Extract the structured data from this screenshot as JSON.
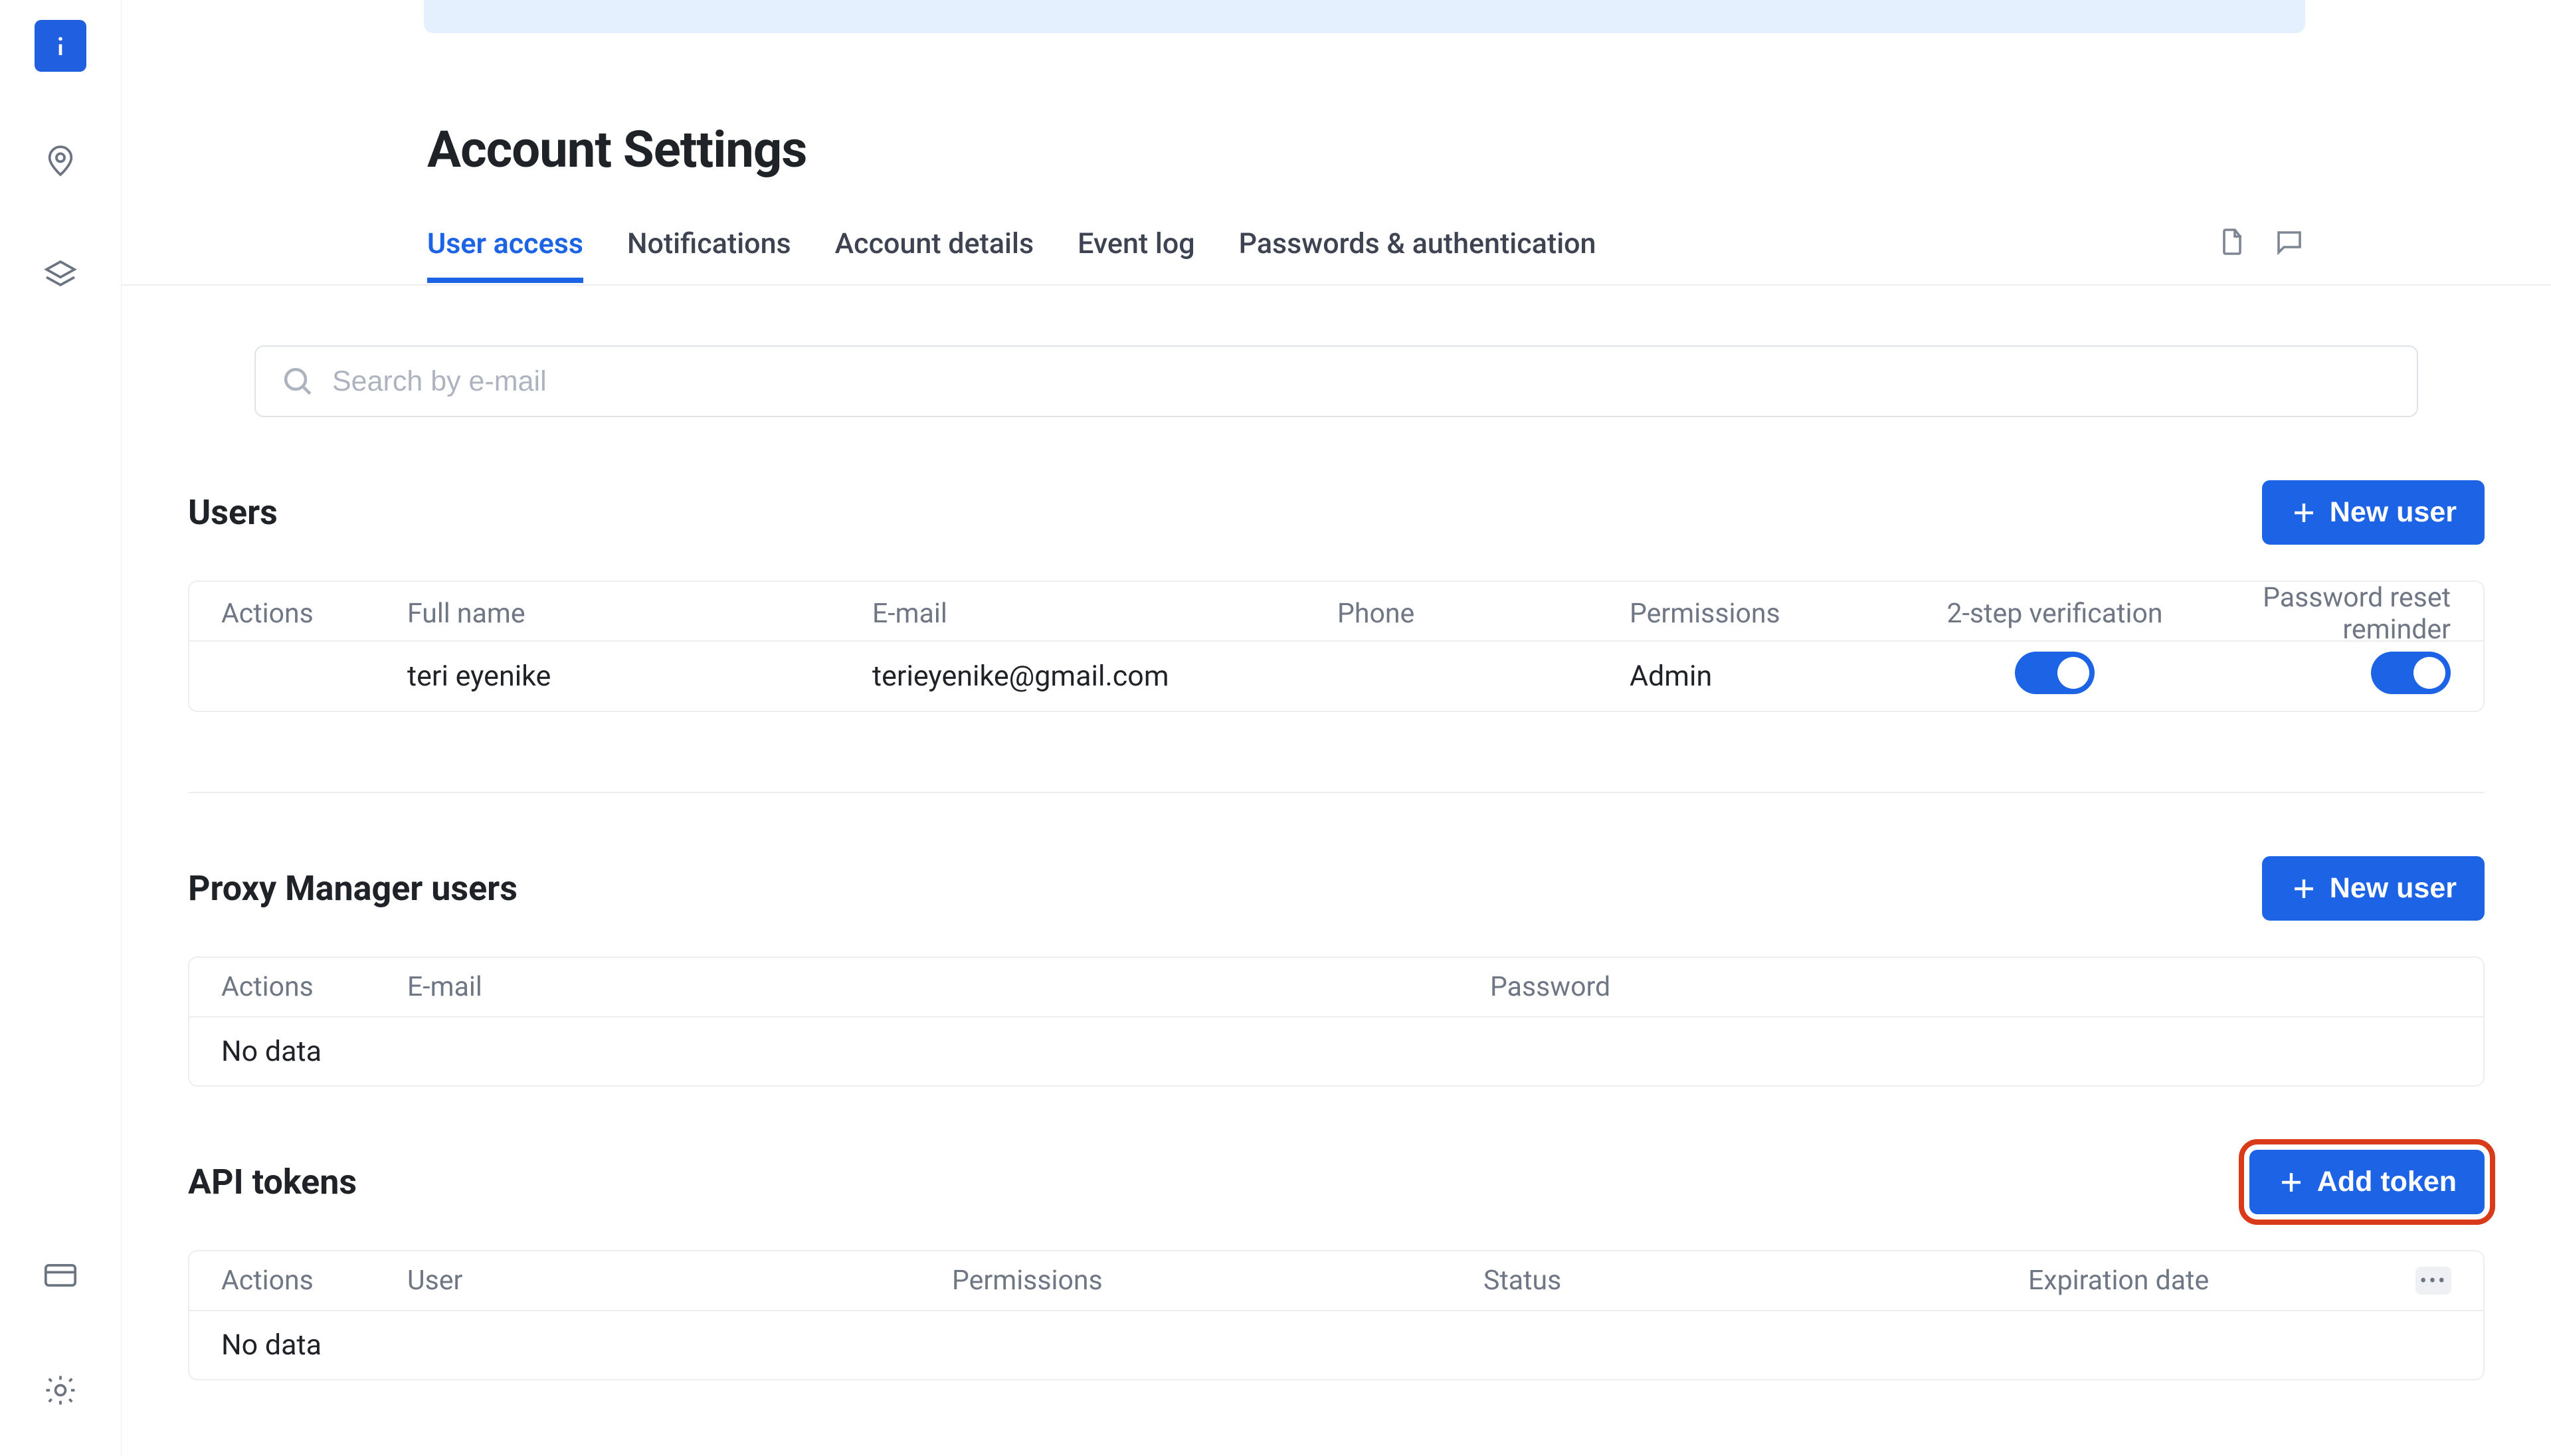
{
  "page": {
    "title": "Account Settings"
  },
  "tabs": {
    "user_access": "User access",
    "notifications": "Notifications",
    "account_details": "Account details",
    "event_log": "Event log",
    "passwords_auth": "Passwords & authentication"
  },
  "search": {
    "placeholder": "Search by e-mail"
  },
  "sections": {
    "users": {
      "title": "Users",
      "new_btn": "New user",
      "cols": {
        "actions": "Actions",
        "full_name": "Full name",
        "email": "E-mail",
        "phone": "Phone",
        "permissions": "Permissions",
        "two_step": "2-step verification",
        "pwd_reset": "Password reset reminder"
      },
      "rows": [
        {
          "actions": "",
          "full_name": "teri eyenike",
          "email": "terieyenike@gmail.com",
          "phone": "",
          "permissions": "Admin",
          "two_step_on": true,
          "pwd_reset_on": true
        }
      ]
    },
    "proxy": {
      "title": "Proxy Manager users",
      "new_btn": "New user",
      "cols": {
        "actions": "Actions",
        "email": "E-mail",
        "password": "Password"
      },
      "no_data": "No data"
    },
    "api": {
      "title": "API tokens",
      "add_btn": "Add token",
      "cols": {
        "actions": "Actions",
        "user": "User",
        "permissions": "Permissions",
        "status": "Status",
        "expiration": "Expiration date"
      },
      "no_data": "No data"
    }
  }
}
